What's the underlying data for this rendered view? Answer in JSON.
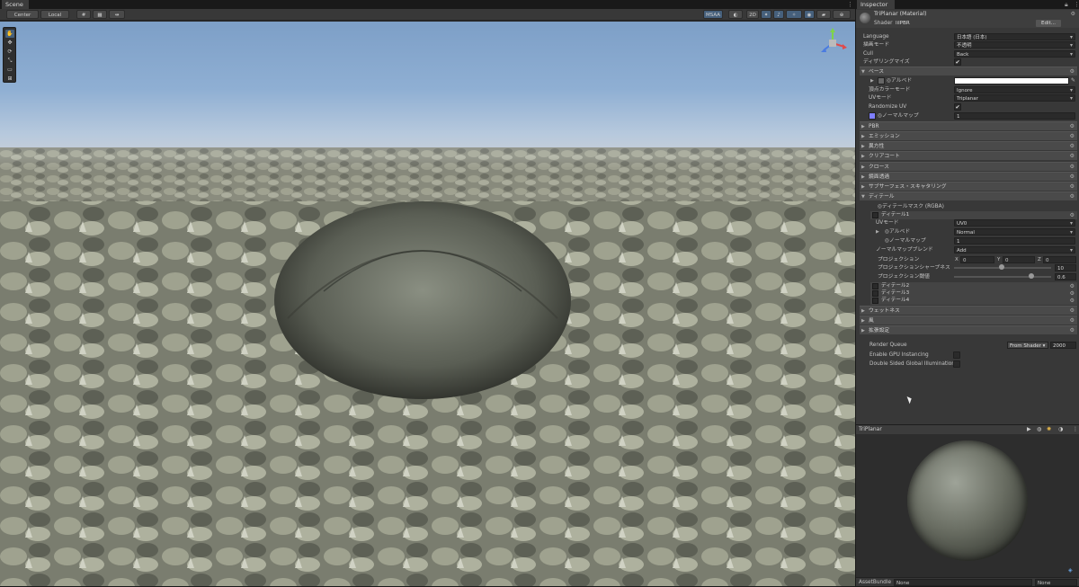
{
  "scene": {
    "tab_label": "Scene",
    "toolbar": {
      "pivot_label": "Center",
      "space_label": "Local",
      "msaa_label": "MSAA",
      "mode_2d_label": "2D"
    }
  },
  "inspector": {
    "tab_label": "Inspector",
    "material_title": "TriPlanar (Material)",
    "shader_label": "Shader",
    "shader_value": "lilPBR",
    "edit_button": "Edit...",
    "fields": [
      {
        "label": "Language",
        "value": "日本語 (日本)"
      },
      {
        "label": "描画モード",
        "value": "不透明"
      },
      {
        "label": "Cull",
        "value": "Back"
      },
      {
        "label": "ディザリングマイズ",
        "value": "✔"
      }
    ],
    "base_section": {
      "title": "ベース",
      "albedo_label": "◎アルベド",
      "vertex_color_label": "頂点カラーモード",
      "vertex_color_value": "Ignore",
      "uv_mode_label": "UVモード",
      "uv_mode_value": "Triplanar",
      "randomize_uv_label": "Randomize UV",
      "randomize_uv_value": "✔",
      "normal_map_label": "◎ノーマルマップ",
      "normal_map_value": "1"
    },
    "sections": [
      "PBR",
      "エミッション",
      "異方性",
      "クリアコート",
      "クロース",
      "鏡面透過",
      "サブサーフェス・スキャタリング"
    ],
    "detail_section": {
      "title": "ディテール",
      "mask_label": "◎ディテールマスク (RGBA)",
      "detail1_title": "ディテール1",
      "uv_mode_label": "UVモード",
      "uv_mode_value": "UV0",
      "albedo_label": "◎アルベド",
      "albedo_value": "Normal",
      "normal_label": "◎ノーマルマップ",
      "normal_value": "1",
      "normal_blend_label": "ノーマルマップブレンド",
      "normal_blend_value": "Add",
      "projection_label": "プロジェクション",
      "proj_x_label": "X",
      "proj_x": "0",
      "proj_y_label": "Y",
      "proj_y": "0",
      "proj_z_label": "Z",
      "proj_z": "0",
      "sharpness_label": "プロジェクションシャープネス",
      "sharpness_value": "10",
      "threshold_label": "プロジェクション閾値",
      "threshold_value": "0.6",
      "detail2_title": "ディテール2",
      "detail3_title": "ディテール3",
      "detail4_title": "ディテール4"
    },
    "sections_after": [
      "ウェットネス",
      "風",
      "拡張設定"
    ],
    "render_queue_label": "Render Queue",
    "render_queue_mode": "From Shader",
    "render_queue_value": "2000",
    "gpu_instancing_label": "Enable GPU Instancing",
    "double_sided_gi_label": "Double Sided Global Illumination",
    "preview_title": "TriPlanar",
    "assetbundle_label": "AssetBundle",
    "assetbundle_value": "None",
    "assetbundle_variant": "None"
  }
}
